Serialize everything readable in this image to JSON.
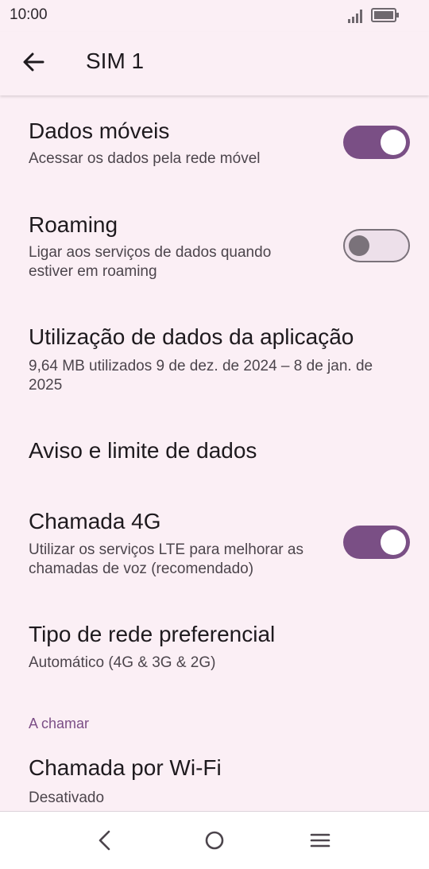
{
  "status_bar": {
    "time": "10:00",
    "icons": [
      "signal-icon",
      "battery-icon"
    ]
  },
  "app_bar": {
    "title": "SIM 1",
    "back_icon": "arrow-back-icon"
  },
  "settings": {
    "mobile_data": {
      "title": "Dados móveis",
      "subtitle": "Acessar os dados pela rede móvel",
      "enabled": true
    },
    "roaming": {
      "title": "Roaming",
      "subtitle": "Ligar aos serviços de dados quando estiver em roaming",
      "enabled": false
    },
    "app_data_usage": {
      "title": "Utilização de dados da aplicação",
      "subtitle": "9,64 MB utilizados 9 de dez. de 2024 – 8 de jan. de 2025"
    },
    "data_warning": {
      "title": "Aviso e limite de dados"
    },
    "call_4g": {
      "title": "Chamada 4G",
      "subtitle": "Utilizar os serviços LTE para melhorar as chamadas de voz (recomendado)",
      "enabled": true
    },
    "network_type": {
      "title": "Tipo de rede preferencial",
      "subtitle": "Automático (4G & 3G & 2G)"
    },
    "calling_section": {
      "header": "A chamar"
    },
    "wifi_calling": {
      "title": "Chamada por Wi-Fi",
      "subtitle": "Desativado"
    }
  },
  "nav_bar": {
    "icons": [
      "nav-back-icon",
      "nav-home-icon",
      "nav-menu-icon"
    ]
  },
  "colors": {
    "background": "#FBEFF5",
    "accent": "#7A4F85",
    "section_header": "#7B4E86",
    "text_primary": "#1E1A1E",
    "text_secondary": "#4C454C"
  }
}
